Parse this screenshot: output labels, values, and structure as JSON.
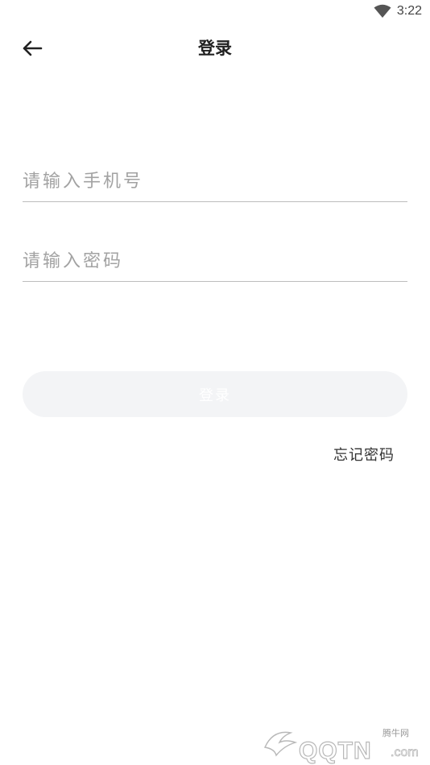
{
  "status_bar": {
    "time": "3:22",
    "wifi_icon": "wifi-icon"
  },
  "header": {
    "title": "登录",
    "back_icon": "arrow-left-icon"
  },
  "form": {
    "phone_placeholder": "请输入手机号",
    "password_placeholder": "请输入密码",
    "login_label": "登录",
    "forgot_label": "忘记密码"
  },
  "watermark": {
    "small": "腾牛网",
    "main": "QQTN",
    "suffix": ".com"
  },
  "colors": {
    "button_bg": "#f3f4f6",
    "placeholder": "#a2a2a2",
    "divider": "#bdbdbd"
  }
}
